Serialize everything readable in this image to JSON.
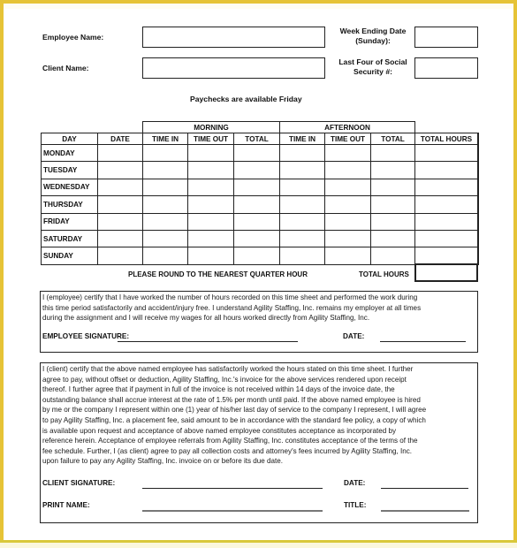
{
  "header": {
    "employee_name_label": "Employee Name:",
    "employee_name_value": "",
    "client_name_label": "Client Name:",
    "client_name_value": "",
    "week_ending_label_line1": "Week Ending Date",
    "week_ending_label_line2": "(Sunday):",
    "week_ending_value": "",
    "ssn_label_line1": "Last Four of Social",
    "ssn_label_line2": "Security #:",
    "ssn_value": "",
    "paycheck_notice": "Paychecks are available Friday"
  },
  "timesheet": {
    "group_headers": {
      "morning": "MORNING",
      "afternoon": "AFTERNOON"
    },
    "columns": [
      "DAY",
      "DATE",
      "TIME IN",
      "TIME OUT",
      "TOTAL",
      "TIME IN",
      "TIME OUT",
      "TOTAL",
      "TOTAL HOURS"
    ],
    "rows": [
      {
        "day": "MONDAY",
        "date": "",
        "am_in": "",
        "am_out": "",
        "am_total": "",
        "pm_in": "",
        "pm_out": "",
        "pm_total": "",
        "total_hours": ""
      },
      {
        "day": "TUESDAY",
        "date": "",
        "am_in": "",
        "am_out": "",
        "am_total": "",
        "pm_in": "",
        "pm_out": "",
        "pm_total": "",
        "total_hours": ""
      },
      {
        "day": "WEDNESDAY",
        "date": "",
        "am_in": "",
        "am_out": "",
        "am_total": "",
        "pm_in": "",
        "pm_out": "",
        "pm_total": "",
        "total_hours": ""
      },
      {
        "day": "THURSDAY",
        "date": "",
        "am_in": "",
        "am_out": "",
        "am_total": "",
        "pm_in": "",
        "pm_out": "",
        "pm_total": "",
        "total_hours": ""
      },
      {
        "day": "FRIDAY",
        "date": "",
        "am_in": "",
        "am_out": "",
        "am_total": "",
        "pm_in": "",
        "pm_out": "",
        "pm_total": "",
        "total_hours": ""
      },
      {
        "day": "SATURDAY",
        "date": "",
        "am_in": "",
        "am_out": "",
        "am_total": "",
        "pm_in": "",
        "pm_out": "",
        "pm_total": "",
        "total_hours": ""
      },
      {
        "day": "SUNDAY",
        "date": "",
        "am_in": "",
        "am_out": "",
        "am_total": "",
        "pm_in": "",
        "pm_out": "",
        "pm_total": "",
        "total_hours": ""
      }
    ],
    "rounding_notice": "PLEASE ROUND TO THE NEAREST QUARTER HOUR",
    "grand_total_label": "TOTAL HOURS",
    "grand_total_value": ""
  },
  "employee_certification": {
    "lines": [
      "I (employee) certify that I have worked the number of hours recorded on this time sheet and performed the work during",
      "this time period satisfactorily and accident/injury free.  I understand Agility Staffing, Inc. remains my employer at all times",
      "during the assignment and I will receive my wages for all hours worked directly from Agility Staffing, Inc."
    ],
    "signature_label": "EMPLOYEE SIGNATURE:",
    "date_label": "DATE:"
  },
  "client_certification": {
    "lines": [
      "I (client) certify that the above named employee has satisfactorily worked the hours stated on this time sheet. I further",
      "agree to pay, without offset or deduction, Agility Staffing, Inc.'s invoice for the above services rendered upon receipt",
      "thereof.  I further agree that if payment in full of the invoice is not received within 14 days of the invoice date, the",
      "outstanding balance shall accrue interest at the rate of 1.5% per month until paid.  If the above named employee is hired",
      "by me or the company I represent within one (1) year of his/her last day of service to the company I represent, I will agree",
      "to pay Agility Staffing, Inc. a placement fee, said amount to be in accordance with the standard fee policy, a copy of which",
      "is available upon request and acceptance of above named employee constitutes acceptance as incorporated by",
      "reference herein.  Acceptance of employee referrals from Agility Staffing, Inc. constitutes acceptance of the terms of the",
      "fee schedule.  Further, I (as client) agree to pay all collection costs and attorney's fees incurred by Agility Staffing, Inc.",
      "upon failure to pay any Agility Staffing, Inc. invoice on or before its due date."
    ],
    "signature_label": "CLIENT SIGNATURE:",
    "date_label": "DATE:",
    "print_name_label": "PRINT NAME:",
    "title_label": "TITLE:"
  },
  "colors": {
    "frame": "#e6c337",
    "ink": "#222222"
  }
}
